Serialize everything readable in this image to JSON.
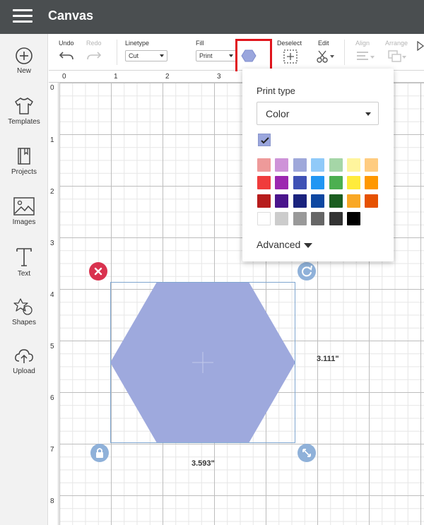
{
  "header": {
    "title": "Canvas"
  },
  "sidebar": {
    "items": [
      {
        "label": "New",
        "icon": "plus-circle-icon"
      },
      {
        "label": "Templates",
        "icon": "shirt-icon"
      },
      {
        "label": "Projects",
        "icon": "book-icon"
      },
      {
        "label": "Images",
        "icon": "image-icon"
      },
      {
        "label": "Text",
        "icon": "text-icon"
      },
      {
        "label": "Shapes",
        "icon": "shapes-icon"
      },
      {
        "label": "Upload",
        "icon": "upload-cloud-icon"
      }
    ]
  },
  "toolbar": {
    "undo_label": "Undo",
    "redo_label": "Redo",
    "linetype_label": "Linetype",
    "linetype_value": "Cut",
    "fill_label": "Fill",
    "fill_value": "Print",
    "fill_color": "#9aa6dd",
    "deselect_label": "Deselect",
    "edit_label": "Edit",
    "align_label": "Align",
    "arrange_label": "Arrange"
  },
  "ruler": {
    "top": [
      "0",
      "1",
      "2",
      "3"
    ],
    "left": [
      "0",
      "1",
      "2",
      "3",
      "4",
      "5",
      "6",
      "7",
      "8"
    ]
  },
  "canvas": {
    "shape": {
      "type": "hexagon",
      "fill": "#9ea9dd"
    },
    "width_label": "3.593\"",
    "height_label": "3.111\""
  },
  "fill_popup": {
    "title": "Print type",
    "select_value": "Color",
    "current_color": "#9aa6dd",
    "advanced_label": "Advanced",
    "palette": [
      [
        "#ee9a9a",
        "#ce93d8",
        "#9fa8da",
        "#90caf9",
        "#a5d6a7",
        "#fff59d",
        "#ffcc80"
      ],
      [
        "#f03c3c",
        "#9c27b0",
        "#3f51b5",
        "#2196f3",
        "#4caf50",
        "#ffeb3b",
        "#ff9800"
      ],
      [
        "#b71c1c",
        "#4a148c",
        "#1a237e",
        "#0d47a1",
        "#1b5e20",
        "#f9a825",
        "#e65100"
      ],
      [
        "#ffffff",
        "#cccccc",
        "#999999",
        "#666666",
        "#333333",
        "#000000"
      ]
    ]
  }
}
